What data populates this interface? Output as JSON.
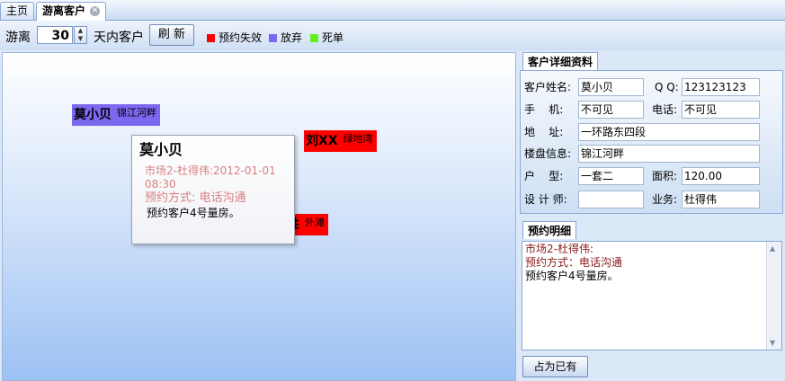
{
  "tabs": [
    {
      "label": "主页",
      "active": false
    },
    {
      "label": "游离客户",
      "active": true,
      "closable": true
    }
  ],
  "toolbar": {
    "prefix_label": "游离",
    "days_value": "30",
    "suffix_label": "天内客户",
    "refresh_label": "刷 新",
    "legend": [
      {
        "label": "预约失效",
        "color": "#ff0000"
      },
      {
        "label": "放弃",
        "color": "#7b68ee"
      },
      {
        "label": "死单",
        "color": "#66ee22"
      }
    ]
  },
  "canvas": {
    "clients": [
      {
        "name": "莫小贝",
        "location": "锦江河畔",
        "color": "#7b68ee"
      },
      {
        "name": "刘XX",
        "location": "绿地湾",
        "color": "#ff0000"
      },
      {
        "name": "陈胜",
        "location": "外滩",
        "color": "#ff0000"
      }
    ],
    "popup": {
      "name": "莫小贝",
      "line1": "市场2-杜得伟:2012-01-01",
      "line2": "08:30",
      "method": "预约方式:  电话沟通",
      "remark": "预约客户4号量房。"
    }
  },
  "detail": {
    "tab_label": "客户详细资料",
    "fields": {
      "name_label": "客户姓名:",
      "name_value": "莫小贝",
      "qq_label": "Q Q:",
      "qq_value": "123123123",
      "mobile_label": "手    机:",
      "mobile_value": "不可见",
      "phone_label": "电话:",
      "phone_value": "不可见",
      "address_label": "地    址:",
      "address_value": "一环路东四段",
      "building_label": "楼盘信息:",
      "building_value": "锦江河畔",
      "layout_label": "户    型:",
      "layout_value": "一套二",
      "area_label": "面积:",
      "area_value": "120.00",
      "designer_label": "设 计 师:",
      "designer_value": "",
      "sales_label": "业务:",
      "sales_value": "杜得伟"
    }
  },
  "appointment": {
    "tab_label": "预约明细",
    "line1": "市场2-杜得伟:",
    "line2": "预约方式：电话沟通",
    "line3": "预约客户4号量房。"
  },
  "occupy_button": "占为已有"
}
